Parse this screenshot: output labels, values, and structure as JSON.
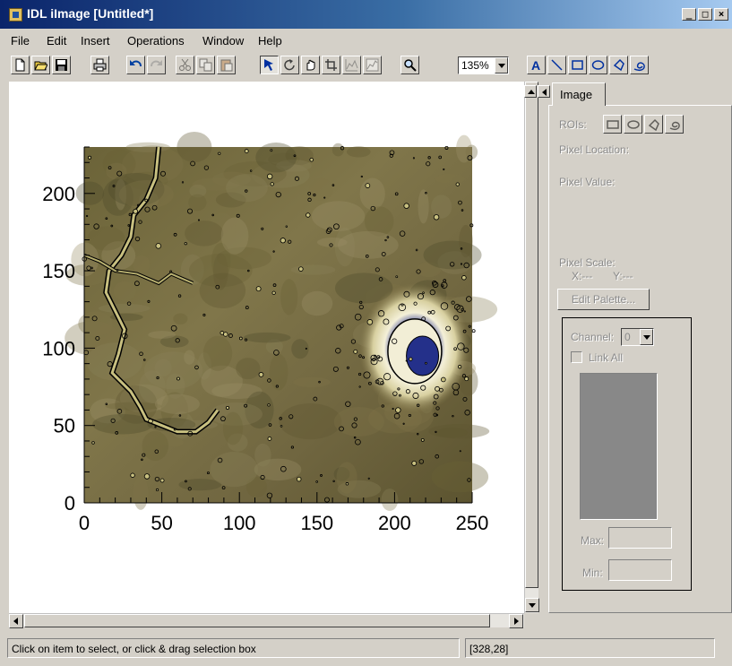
{
  "window": {
    "title": "IDL iImage [Untitled*]",
    "minimize": "_",
    "maximize": "□",
    "close": "×"
  },
  "menu": [
    {
      "id": "file",
      "label": "File"
    },
    {
      "id": "edit",
      "label": "Edit"
    },
    {
      "id": "insert",
      "label": "Insert"
    },
    {
      "id": "operations",
      "label": "Operations"
    },
    {
      "id": "window",
      "label": "Window"
    },
    {
      "id": "help",
      "label": "Help"
    }
  ],
  "toolbar": {
    "zoom_value": "135%",
    "icons": [
      "new-file-icon",
      "open-folder-icon",
      "save-icon",
      "print-icon",
      "undo-icon",
      "redo-icon",
      "cut-icon",
      "copy-icon",
      "paste-icon",
      "select-arrow-icon",
      "rotate-icon",
      "pan-hand-icon",
      "crop-icon",
      "line-profile-icon",
      "histogram-icon",
      "zoom-magnifier-icon",
      "text-annotation-icon",
      "line-annotation-icon",
      "rectangle-annotation-icon",
      "ellipse-annotation-icon",
      "polygon-annotation-icon",
      "freehand-annotation-icon"
    ]
  },
  "chart_data": {
    "type": "heatmap",
    "title": "",
    "xlabel": "",
    "ylabel": "",
    "xlim": [
      0,
      250
    ],
    "ylim": [
      0,
      230
    ],
    "x_ticks": [
      0,
      50,
      100,
      150,
      200,
      250
    ],
    "y_ticks": [
      0,
      50,
      100,
      150,
      200
    ],
    "image": "satellite image of terrain with crater and black contour overlay"
  },
  "panel": {
    "tab_label": "Image",
    "rois_label": "ROIs:",
    "pixel_location_label": "Pixel Location:",
    "pixel_value_label": "Pixel Value:",
    "pixel_scale_label": "Pixel Scale:",
    "pixel_scale_x": "X:---",
    "pixel_scale_y": "Y:---",
    "edit_palette_label": "Edit Palette...",
    "channel_label": "Channel:",
    "channel_value": "0",
    "link_all_label": "Link All",
    "max_label": "Max:",
    "min_label": "Min:"
  },
  "status": {
    "message": "Click on item to select, or click & drag selection box",
    "coords": "[328,28]"
  },
  "colors": {
    "title_gradient_start": "#0a246a",
    "title_gradient_end": "#a6caf0",
    "chrome": "#d4d0c8"
  }
}
